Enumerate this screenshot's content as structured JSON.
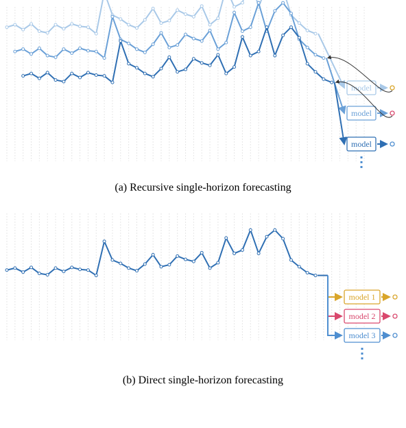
{
  "captions": {
    "a": "(a)  Recursive single-horizon forecasting",
    "b": "(b)  Direct single-horizon forecasting"
  },
  "chart_data": [
    {
      "role": "panel-a",
      "type": "line",
      "title": "",
      "xlim": [
        0,
        38
      ],
      "ylim": [
        0,
        190
      ],
      "series_base": [
        105,
        108,
        102,
        109,
        100,
        98,
        108,
        103,
        109,
        106,
        105,
        97,
        148,
        120,
        115,
        108,
        104,
        114,
        128,
        110,
        113,
        126,
        121,
        118,
        131,
        108,
        116,
        153,
        130,
        135,
        165,
        130,
        155,
        165,
        152,
        120,
        110,
        101,
        97
      ],
      "offsets": {
        "light": 60,
        "medium": 30,
        "dark": 0
      },
      "model_label": "model",
      "arrow_colors": {
        "light": "#a9c9e8",
        "medium": "#6aa0d7",
        "dark": "#2f6fb3"
      },
      "feedback_arrows": true,
      "pred_colors": {
        "light": "#d9a52a",
        "medium": "#d9486d",
        "dark": "#4e8ed0"
      }
    },
    {
      "role": "panel-b",
      "type": "line",
      "title": "",
      "xlim": [
        0,
        38
      ],
      "ylim": [
        0,
        190
      ],
      "series_base": [
        105,
        108,
        102,
        109,
        100,
        98,
        108,
        103,
        109,
        106,
        105,
        97,
        148,
        120,
        115,
        108,
        104,
        114,
        128,
        110,
        113,
        126,
        121,
        118,
        131,
        108,
        116,
        153,
        130,
        135,
        165,
        130,
        155,
        165,
        152,
        120,
        110,
        101,
        97
      ],
      "models": [
        {
          "label": "model 1",
          "color": "#d9a52a"
        },
        {
          "label": "model 2",
          "color": "#d9486d"
        },
        {
          "label": "model 3",
          "color": "#4e8ed0"
        }
      ]
    }
  ]
}
